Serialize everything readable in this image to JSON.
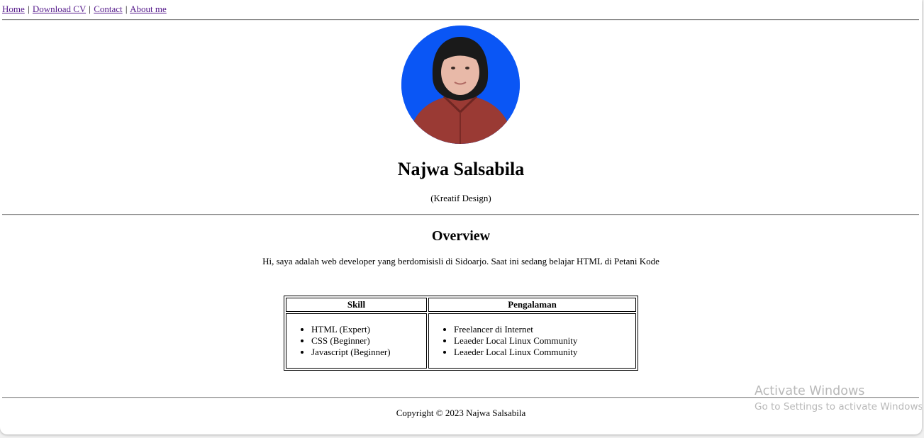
{
  "nav": {
    "links": [
      "Home",
      "Download CV",
      "Contact",
      "About me"
    ],
    "separator": "|"
  },
  "profile": {
    "name": "Najwa Salsabila",
    "subtitle": "(Kreatif Design)",
    "photo_bg_color": "#0a56f5"
  },
  "overview": {
    "heading": "Overview",
    "text": "Hi, saya adalah web developer yang berdomisisli di Sidoarjo. Saat ini sedang belajar HTML di Petani Kode"
  },
  "table": {
    "headers": [
      "Skill",
      "Pengalaman"
    ],
    "skills": [
      "HTML (Expert)",
      "CSS (Beginner)",
      "Javascript (Beginner)"
    ],
    "experience": [
      "Freelancer di Internet",
      "Leaeder Local Linux Community",
      "Leaeder Local Linux Community"
    ]
  },
  "footer": {
    "copyright": "Copyright © 2023 Najwa Salsabila"
  },
  "watermark": {
    "title": "Activate Windows",
    "subtitle": "Go to Settings to activate Windows."
  },
  "colors": {
    "link": "#551a8b",
    "divider": "#8c8c8c"
  }
}
